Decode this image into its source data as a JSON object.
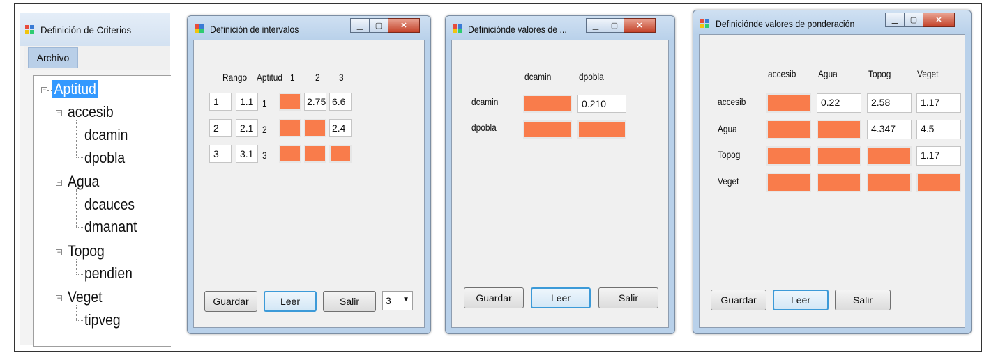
{
  "tree_window": {
    "title": "Definición de Criterios",
    "menu": "Archivo",
    "root": "Aptitud",
    "nodes": [
      {
        "label": "accesib",
        "children": [
          "dcamin",
          "dpobla"
        ]
      },
      {
        "label": "Agua",
        "children": [
          "dcauces",
          "dmanant"
        ]
      },
      {
        "label": "Topog",
        "children": [
          "pendien"
        ]
      },
      {
        "label": "Veget",
        "children": [
          "tipveg"
        ]
      }
    ]
  },
  "intervals_window": {
    "title": "Definición de intervalos",
    "headers": {
      "rango": "Rango",
      "aptitud": "Aptitud",
      "c1": "1",
      "c2": "2",
      "c3": "3"
    },
    "rows": [
      {
        "rango": "1",
        "val": "1.1",
        "aptitud": "1",
        "c2": "2.75",
        "c3": "6.6"
      },
      {
        "rango": "2",
        "val": "2.1",
        "aptitud": "2",
        "c3": "2.4"
      },
      {
        "rango": "3",
        "val": "3.1",
        "aptitud": "3"
      }
    ],
    "buttons": {
      "save": "Guardar",
      "read": "Leer",
      "exit": "Salir"
    },
    "combo_value": "3"
  },
  "values_window": {
    "title": "Definiciónde valores de ...",
    "col_headers": [
      "dcamin",
      "dpobla"
    ],
    "row_labels": [
      "dcamin",
      "dpobla"
    ],
    "value_dcamin_dpobla": "0.210",
    "buttons": {
      "save": "Guardar",
      "read": "Leer",
      "exit": "Salir"
    }
  },
  "weights_window": {
    "title": "Definiciónde valores de ponderación",
    "col_headers": [
      "accesib",
      "Agua",
      "Topog",
      "Veget"
    ],
    "row_labels": [
      "accesib",
      "Agua",
      "Topog",
      "Veget"
    ],
    "values": {
      "accesib_agua": "0.22",
      "accesib_topog": "2.58",
      "accesib_veget": "1.17",
      "agua_topog": "4.347",
      "agua_veget": "4.5",
      "topog_veget": "1.17"
    },
    "buttons": {
      "save": "Guardar",
      "read": "Leer",
      "exit": "Salir"
    }
  },
  "colors": {
    "cell_orange": "#f97c4b",
    "selection": "#3399ff",
    "title_gradient": "#b9d1ea"
  }
}
